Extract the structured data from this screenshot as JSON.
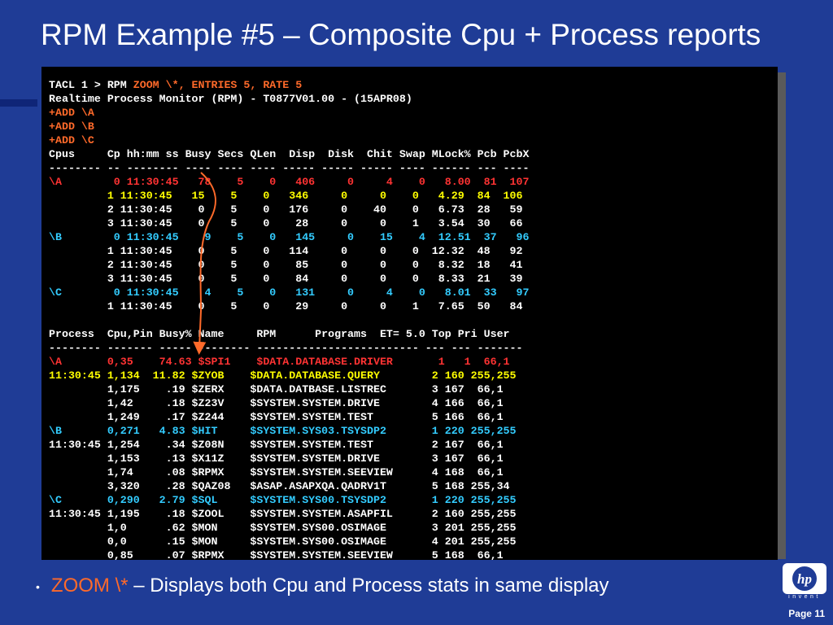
{
  "slide_title": "RPM Example #5 – Composite Cpu + Process reports",
  "terminal": {
    "lines": [
      [
        {
          "t": "TACL 1 > RPM ",
          "c": "w"
        },
        {
          "t": "ZOOM \\*, ENTRIES 5, RATE 5",
          "c": "o"
        }
      ],
      [
        {
          "t": "Realtime Process Monitor (RPM) - T0877V01.00 - (15APR08)",
          "c": "w"
        }
      ],
      [
        {
          "t": "+ADD \\A",
          "c": "o"
        }
      ],
      [
        {
          "t": "+ADD \\B",
          "c": "o"
        }
      ],
      [
        {
          "t": "+ADD \\C",
          "c": "o"
        }
      ],
      [
        {
          "t": "Cpus     Cp hh:mm ss Busy Secs QLen  Disp  Disk  Chit Swap MLock% Pcb PcbX",
          "c": "w"
        }
      ],
      [
        {
          "t": "-------- -- -------- ---- ---- ---- ----- ----- ----- ---- ------ --- ----",
          "c": "w"
        }
      ],
      [
        {
          "t": "\\A        0 11:30:45   78    5    0   406     0     4    0   8.00  81  107",
          "c": "r"
        }
      ],
      [
        {
          "t": "         1 11:30:45   15    5    0   346     0     0    0   4.29  84  106",
          "c": "y"
        }
      ],
      [
        {
          "t": "         2 11:30:45    0    5    0   176     0    40    0   6.73  28   59",
          "c": "w"
        }
      ],
      [
        {
          "t": "         3 11:30:45    0    5    0    28     0     0    1   3.54  30   66",
          "c": "w"
        }
      ],
      [
        {
          "t": "\\B        0 11:30:45    9    5    0   145     0    15    4  12.51  37   96",
          "c": "c"
        }
      ],
      [
        {
          "t": "         1 11:30:45    0    5    0   114     0     0    0  12.32  48   92",
          "c": "w"
        }
      ],
      [
        {
          "t": "         2 11:30:45    0    5    0    85     0     0    0   8.32  18   41",
          "c": "w"
        }
      ],
      [
        {
          "t": "         3 11:30:45    0    5    0    84     0     0    0   8.33  21   39",
          "c": "w"
        }
      ],
      [
        {
          "t": "\\C        0 11:30:45    4    5    0   131     0     4    0   8.01  33   97",
          "c": "c"
        }
      ],
      [
        {
          "t": "         1 11:30:45    0    5    0    29     0     0    1   7.65  50   84",
          "c": "w"
        }
      ],
      [
        {
          "t": "",
          "c": "w"
        }
      ],
      [
        {
          "t": "Process  Cpu,Pin Busy% Name     RPM      Programs  ET= 5.0 Top Pri User",
          "c": "w"
        }
      ],
      [
        {
          "t": "-------- ------- ----- -------- ------------------------- --- --- -------",
          "c": "w"
        }
      ],
      [
        {
          "t": "\\A       0,35    74.63 $SPI1    $DATA.DATABASE.DRIVER       1   1  66,1",
          "c": "r"
        }
      ],
      [
        {
          "t": "11:30:45 1,134  11.82 $ZYOB    $DATA.DATABASE.QUERY        2 160 255,255",
          "c": "y"
        }
      ],
      [
        {
          "t": "         1,175    .19 $ZERX    $DATA.DATBASE.LISTREC       3 167  66,1",
          "c": "w"
        }
      ],
      [
        {
          "t": "         1,42     .18 $Z23V    $SYSTEM.SYSTEM.DRIVE        4 166  66,1",
          "c": "w"
        }
      ],
      [
        {
          "t": "         1,249    .17 $Z244    $SYSTEM.SYSTEM.TEST         5 166  66,1",
          "c": "w"
        }
      ],
      [
        {
          "t": "\\B       0,271   4.83 $HIT     $SYSTEM.SYS03.TSYSDP2       1 220 255,255",
          "c": "c"
        }
      ],
      [
        {
          "t": "11:30:45 1,254    .34 $Z08N    $SYSTEM.SYSTEM.TEST         2 167  66,1",
          "c": "w"
        }
      ],
      [
        {
          "t": "         1,153    .13 $X11Z    $SYSTEM.SYSTEM.DRIVE        3 167  66,1",
          "c": "w"
        }
      ],
      [
        {
          "t": "         1,74     .08 $RPMX    $SYSTEM.SYSTEM.SEEVIEW      4 168  66,1",
          "c": "w"
        }
      ],
      [
        {
          "t": "         3,320    .28 $QAZ08   $ASAP.ASAPXQA.QADRV1T       5 168 255,34",
          "c": "w"
        }
      ],
      [
        {
          "t": "\\C       0,290   2.79 $SQL     $SYSTEM.SYS00.TSYSDP2       1 220 255,255",
          "c": "c"
        }
      ],
      [
        {
          "t": "11:30:45 1,195    .18 $ZOOL    $SYSTEM.SYSTEM.ASAPFIL      2 160 255,255",
          "c": "w"
        }
      ],
      [
        {
          "t": "         1,0      .62 $MON     $SYSTEM.SYS00.OSIMAGE       3 201 255,255",
          "c": "w"
        }
      ],
      [
        {
          "t": "         0,0      .15 $MON     $SYSTEM.SYS00.OSIMAGE       4 201 255,255",
          "c": "w"
        }
      ],
      [
        {
          "t": "         0,85     .07 $RPMX    $SYSTEM.SYSTEM.SEEVIEW      5 168  66,1",
          "c": "w"
        }
      ]
    ]
  },
  "bullet": {
    "term": "ZOOM \\*",
    "text": " – Displays both Cpu and Process stats in same display"
  },
  "logo": {
    "mark": "hp",
    "tagline": "invent"
  },
  "footer": {
    "page_label": "Page 11"
  },
  "colors": {
    "background": "#1f3c96",
    "terminal_bg": "#000000",
    "highlight_orange": "#ff6a2a",
    "highlight_red": "#ff3333",
    "highlight_yellow": "#ffff00",
    "highlight_cyan": "#33ccff"
  }
}
